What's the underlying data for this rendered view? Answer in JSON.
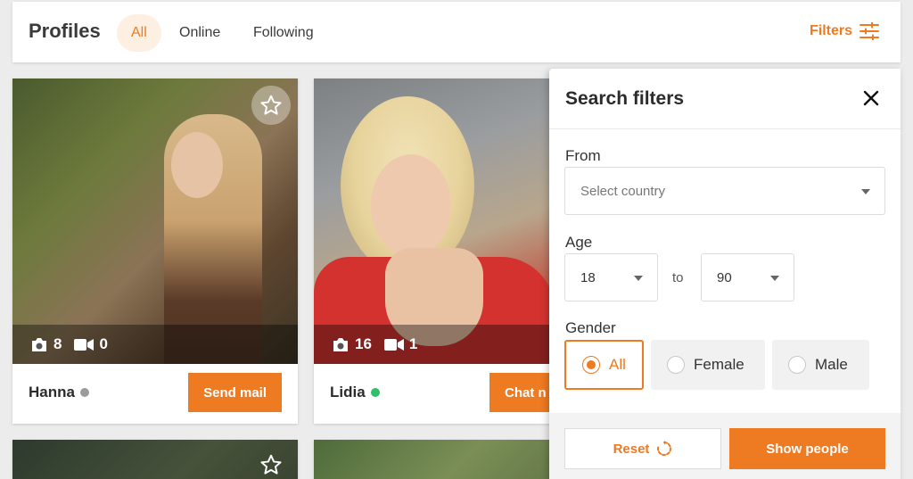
{
  "header": {
    "title": "Profiles",
    "tabs": [
      {
        "label": "All",
        "active": true
      },
      {
        "label": "Online",
        "active": false
      },
      {
        "label": "Following",
        "active": false
      }
    ],
    "filters_label": "Filters",
    "filters_icon": "sliders-icon"
  },
  "profiles": [
    {
      "name": "Hanna",
      "status": "offline",
      "photos": "8",
      "videos": "0",
      "action_label": "Send mail"
    },
    {
      "name": "Lidia",
      "status": "online",
      "photos": "16",
      "videos": "1",
      "action_label": "Chat n"
    }
  ],
  "filters_panel": {
    "title": "Search filters",
    "from_label": "From",
    "country_placeholder": "Select country",
    "age_label": "Age",
    "age_from": "18",
    "age_to_text": "to",
    "age_to": "90",
    "gender_label": "Gender",
    "gender_options": [
      {
        "label": "All",
        "selected": true
      },
      {
        "label": "Female",
        "selected": false
      },
      {
        "label": "Male",
        "selected": false
      }
    ],
    "reset_label": "Reset",
    "show_label": "Show people"
  },
  "colors": {
    "accent": "#ee7a22",
    "accent_light": "#fdf0e2",
    "online": "#2ec06a",
    "offline": "#9a9a9a"
  }
}
